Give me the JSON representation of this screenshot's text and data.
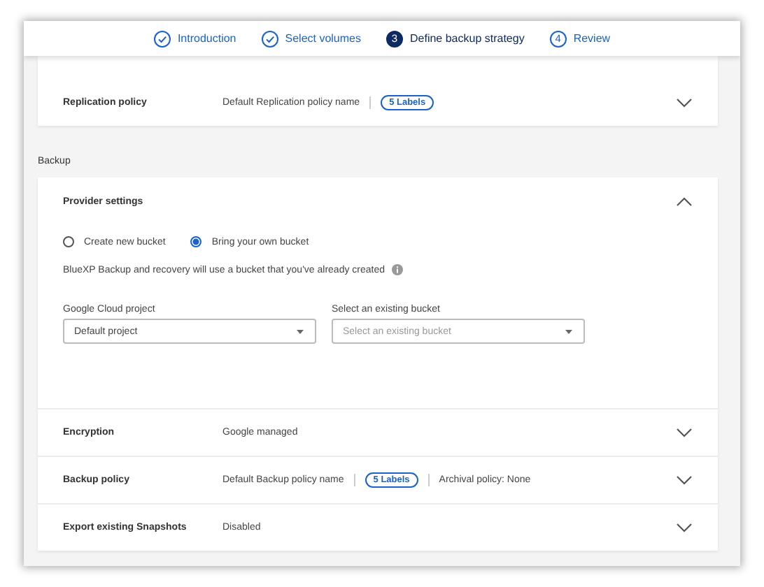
{
  "steps": [
    {
      "done": true,
      "selected": false,
      "label": "Introduction"
    },
    {
      "done": true,
      "selected": false,
      "label": "Select volumes"
    },
    {
      "done": false,
      "selected": true,
      "number": "3",
      "label": "Define backup strategy"
    },
    {
      "done": false,
      "selected": false,
      "number": "4",
      "label": "Review"
    }
  ],
  "replication": {
    "rows": [
      {
        "label": "Replication policy",
        "expanded": false,
        "values": [
          {
            "kind": "text",
            "text": "Default Replication policy name"
          },
          {
            "kind": "badge",
            "text": "5 Labels"
          }
        ]
      }
    ]
  },
  "backup": {
    "title": "Backup",
    "provider": {
      "title": "Provider settings",
      "expanded": true,
      "options": [
        {
          "label": "Create new bucket",
          "selected": false
        },
        {
          "label": "Bring your own bucket",
          "selected": true
        }
      ],
      "info": "BlueXP Backup and recovery will use a bucket that you've already created",
      "fields": [
        {
          "label": "Google Cloud project",
          "value": "Default project"
        },
        {
          "label": "Select an existing bucket",
          "placeholder": "Select an existing bucket"
        }
      ]
    },
    "rows": [
      {
        "label": "Encryption",
        "expanded": false,
        "values": [
          {
            "kind": "text",
            "text": "Google managed"
          }
        ]
      },
      {
        "label": "Backup policy",
        "expanded": false,
        "values": [
          {
            "kind": "text",
            "text": "Default Backup policy name"
          },
          {
            "kind": "badge",
            "text": "5 Labels"
          },
          {
            "kind": "text",
            "text": "Archival policy: None"
          }
        ]
      },
      {
        "label": "Export existing Snapshots",
        "expanded": false,
        "values": [
          {
            "kind": "text",
            "text": "Disabled"
          }
        ]
      }
    ]
  }
}
